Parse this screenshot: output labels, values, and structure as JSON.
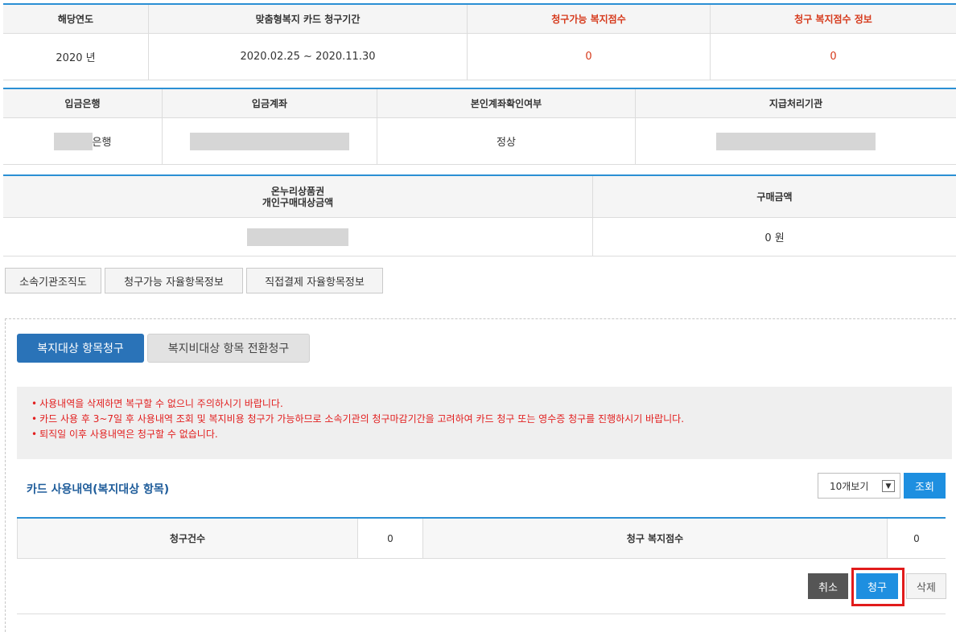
{
  "table1": {
    "headers": [
      "해당연도",
      "맞춤형복지 카드 청구기간",
      "청구가능 복지점수",
      "청구 복지점수 정보"
    ],
    "values": [
      "2020 년",
      "2020.02.25 ~ 2020.11.30",
      "0",
      "0"
    ]
  },
  "table2": {
    "headers": [
      "입금은행",
      "입금계좌",
      "본인계좌확인여부",
      "지급처리기관"
    ],
    "bank_suffix": "은행",
    "account_status": "정상"
  },
  "table3": {
    "header_line1": "온누리상품권",
    "header_line2": "개인구매대상금액",
    "header_amount": "구매금액",
    "amount": "0 원"
  },
  "info_buttons": [
    "소속기관조직도",
    "청구가능 자율항목정보",
    "직접결제 자율항목정보"
  ],
  "tabs": {
    "active": "복지대상 항목청구",
    "inactive": "복지비대상 항목 전환청구"
  },
  "notices": [
    "사용내역을 삭제하면 복구할 수 없으니 주의하시기 바랍니다.",
    "카드 사용 후 3~7일 후 사용내역 조회 및 복지비용 청구가 가능하므로 소속기관의 청구마감기간을 고려하여 카드 청구 또는 영수증 청구를 진행하시기 바랍니다.",
    "퇴직일 이후 사용내역은 청구할 수 없습니다."
  ],
  "card_section": {
    "title": "카드 사용내역(복지대상 항목)",
    "page_size": "10개보기",
    "search_label": "조회"
  },
  "summary": {
    "count_label": "청구건수",
    "count_value": "0",
    "points_label": "청구 복지점수",
    "points_value": "0"
  },
  "actions": {
    "cancel": "취소",
    "claim": "청구",
    "delete": "삭제"
  },
  "colors": {
    "accent": "#2a8fd4",
    "tab_active": "#2a73b8",
    "button_blue": "#1e8fe0",
    "notice_red": "#e21e1e",
    "highlight": "#e11b1b"
  }
}
